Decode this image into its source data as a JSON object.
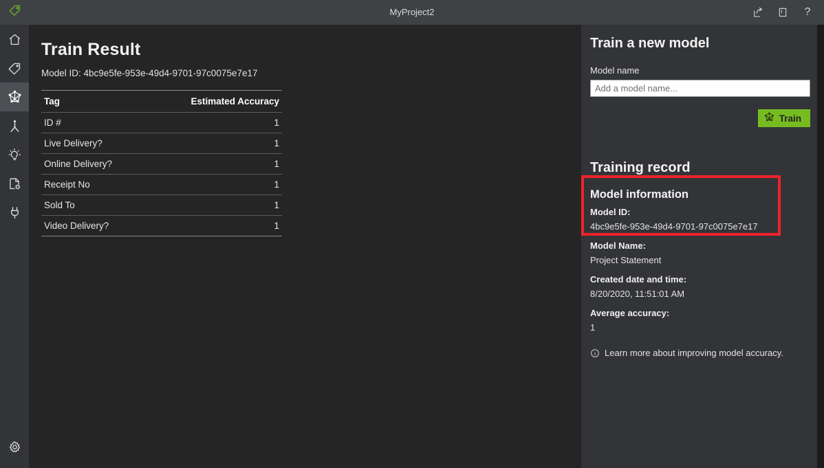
{
  "window": {
    "title": "MyProject2",
    "logo_icon": "tag-logo-icon",
    "actions": [
      {
        "name": "share-icon",
        "glyph": "share"
      },
      {
        "name": "book-icon",
        "glyph": "book"
      },
      {
        "name": "help-icon",
        "glyph": "?"
      }
    ]
  },
  "sidebar": {
    "items": [
      {
        "name": "home-icon",
        "label": "Home",
        "active": false
      },
      {
        "name": "tag-icon",
        "label": "Tag",
        "active": false
      },
      {
        "name": "model-train-icon",
        "label": "Train",
        "active": true
      },
      {
        "name": "person-merge-icon",
        "label": "Compose",
        "active": false
      },
      {
        "name": "lightbulb-icon",
        "label": "Predict",
        "active": false
      },
      {
        "name": "document-gear-icon",
        "label": "Document settings",
        "active": false
      },
      {
        "name": "plug-icon",
        "label": "Connections",
        "active": false
      }
    ],
    "bottom": [
      {
        "name": "gear-icon",
        "label": "Settings"
      }
    ]
  },
  "main": {
    "page_title": "Train Result",
    "model_id_line": "Model ID: 4bc9e5fe-953e-49d4-9701-97c0075e7e17",
    "table": {
      "columns": [
        "Tag",
        "Estimated Accuracy"
      ],
      "rows": [
        {
          "tag": "ID #",
          "accuracy": "1"
        },
        {
          "tag": "Live Delivery?",
          "accuracy": "1"
        },
        {
          "tag": "Online Delivery?",
          "accuracy": "1"
        },
        {
          "tag": "Receipt No",
          "accuracy": "1"
        },
        {
          "tag": "Sold To",
          "accuracy": "1"
        },
        {
          "tag": "Video Delivery?",
          "accuracy": "1"
        }
      ]
    }
  },
  "right_panel": {
    "train_heading": "Train a new model",
    "model_name_label": "Model name",
    "model_name_value": "",
    "model_name_placeholder": "Add a model name...",
    "train_button_label": "Train",
    "training_record_heading": "Training record",
    "model_information": {
      "heading": "Model information",
      "model_id_key": "Model ID:",
      "model_id_value": "4bc9e5fe-953e-49d4-9701-97c0075e7e17",
      "model_name_key": "Model Name:",
      "model_name_value": "Project Statement",
      "created_key": "Created date and time:",
      "created_value": "8/20/2020, 11:51:01 AM",
      "accuracy_key": "Average accuracy:",
      "accuracy_value": "1"
    },
    "learn_more_text": "Learn more about improving model accuracy.",
    "learn_more_icon": "info-circle-icon"
  },
  "colors": {
    "titlebar": "#3f4245",
    "sidebar": "#333438",
    "main_bg": "#252526",
    "panel_bg": "#333437",
    "accent_green": "#76bc21",
    "highlight_red": "#f0222a",
    "edge_dark": "#1b1b1b"
  }
}
